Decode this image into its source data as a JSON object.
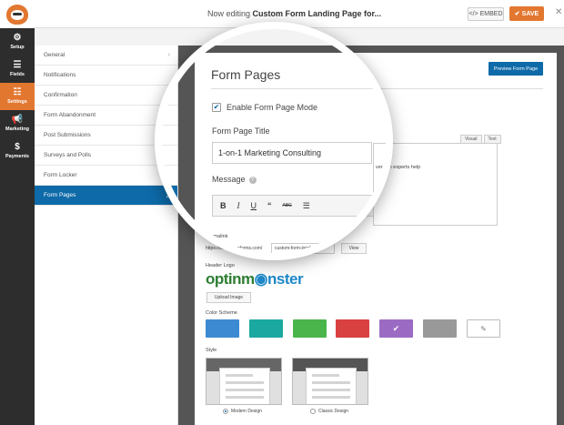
{
  "topbar": {
    "editing_prefix": "Now editing ",
    "form_name": "Custom Form Landing Page for...",
    "embed_label": "EMBED",
    "save_label": "SAVE"
  },
  "leftnav": [
    {
      "label": "Setup",
      "icon": "gear-icon"
    },
    {
      "label": "Fields",
      "icon": "list-icon"
    },
    {
      "label": "Settings",
      "icon": "sliders-icon"
    },
    {
      "label": "Marketing",
      "icon": "megaphone-icon"
    },
    {
      "label": "Payments",
      "icon": "dollar-icon"
    }
  ],
  "settings_menu": [
    "General",
    "Notifications",
    "Confirmation",
    "Form Abandonment",
    "Post Submissions",
    "Surveys and Polls",
    "Form Locker",
    "Form Pages"
  ],
  "form_pages": {
    "title": "Form Pages",
    "preview_button": "Preview Form Page",
    "enable_label": "Enable Form Page Mode",
    "page_title_label": "Form Page Title",
    "page_title_value": "1-on-1 Marketing Consulting",
    "message_label": "Message",
    "editor_tabs": [
      "Visual",
      "Text"
    ],
    "editor_text": "version experts help",
    "permalink_label": "Permalink",
    "permalink_base": "https://testing.wpforms.com/",
    "permalink_slug": "custom-form-landing-p",
    "view_button": "View",
    "header_logo_label": "Header Logo",
    "logo_text_part1": "optin",
    "logo_text_part2": "m",
    "logo_text_part3": "nster",
    "upload_button": "Upload Image",
    "color_scheme_label": "Color Scheme",
    "style_label": "Style",
    "style_options": [
      "Modern Design",
      "Classic Design"
    ]
  },
  "colors": {
    "accent": "#e27730",
    "primary_blue": "#0e6aa8",
    "swatches": [
      "#3c8ad2",
      "#1aa8a0",
      "#49b54b",
      "#d94040",
      "#9b6bc4",
      "#999999",
      "#ffffff"
    ]
  }
}
